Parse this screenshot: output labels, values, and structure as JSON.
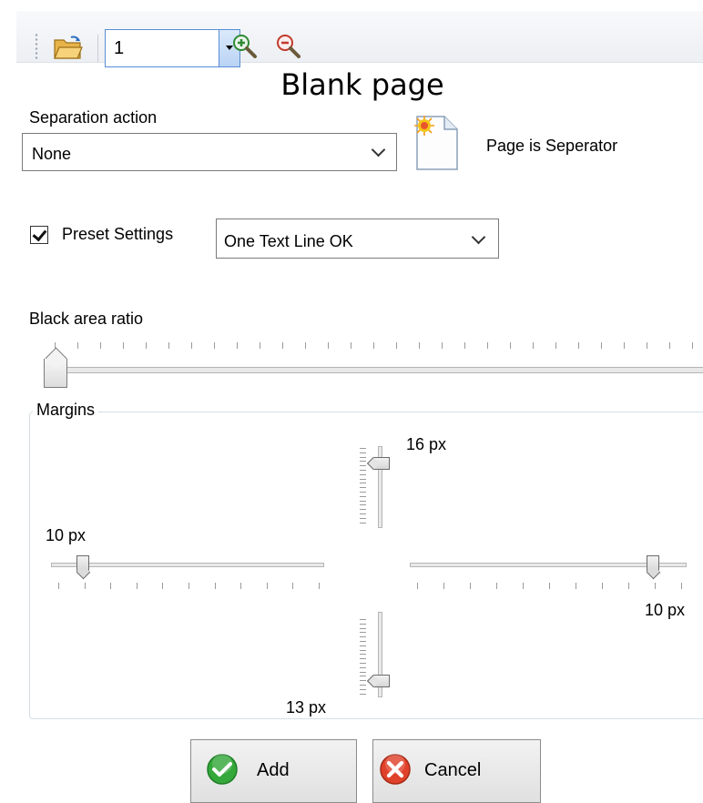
{
  "toolbar": {
    "page_value": "1",
    "icons": [
      "open-folder-icon",
      "zoom-in-icon",
      "zoom-out-icon"
    ]
  },
  "title": "Blank page",
  "separation": {
    "label": "Separation action",
    "value": "None",
    "page_status": "Page is Seperator"
  },
  "preset": {
    "checked": true,
    "label": "Preset Settings",
    "value": "One Text Line OK"
  },
  "black_area": {
    "label": "Black area ratio",
    "level": 0
  },
  "margins": {
    "legend": "Margins",
    "top": "16 px",
    "left": "10 px",
    "right": "10 px",
    "bottom": "13 px"
  },
  "buttons": {
    "add": "Add",
    "cancel": "Cancel"
  },
  "colors": {
    "combo_border": "#5a8ed6",
    "add_icon": "#34a83a",
    "cancel_icon": "#e0412a"
  }
}
